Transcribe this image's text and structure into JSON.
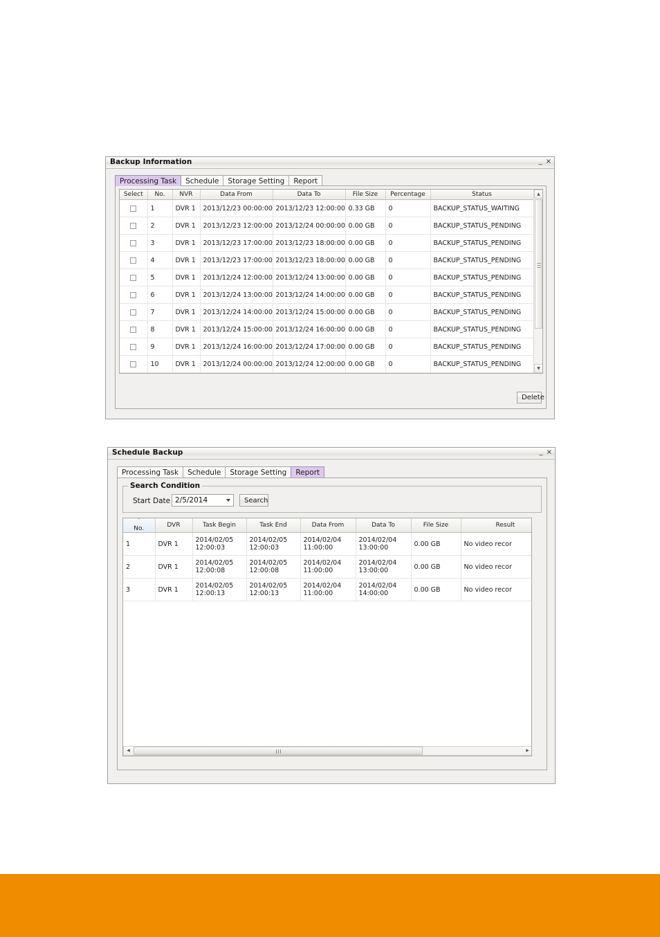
{
  "page": {
    "background": "#ffffff",
    "footer_band_color": "#f08c00"
  },
  "window_backup_information": {
    "title": "Backup Information",
    "minimize_label": "_",
    "close_label": "×",
    "tabs": [
      {
        "label": "Processing Task",
        "selected": true
      },
      {
        "label": "Schedule",
        "selected": false
      },
      {
        "label": "Storage Setting",
        "selected": false
      },
      {
        "label": "Report",
        "selected": false
      }
    ],
    "selected_tab_color": "#ddc8ef",
    "table": {
      "columns": [
        "Select",
        "No.",
        "NVR",
        "Data From",
        "Data To",
        "File Size",
        "Percentage",
        "Status"
      ],
      "rows": [
        {
          "no": "1",
          "nvr": "DVR 1",
          "data_from": "2013/12/23 00:00:00",
          "data_to": "2013/12/23 12:00:00",
          "file_size": "0.33 GB",
          "percentage": "0",
          "status": "BACKUP_STATUS_WAITING"
        },
        {
          "no": "2",
          "nvr": "DVR 1",
          "data_from": "2013/12/23 12:00:00",
          "data_to": "2013/12/24 00:00:00",
          "file_size": "0.00 GB",
          "percentage": "0",
          "status": "BACKUP_STATUS_PENDING"
        },
        {
          "no": "3",
          "nvr": "DVR 1",
          "data_from": "2013/12/23 17:00:00",
          "data_to": "2013/12/23 18:00:00",
          "file_size": "0.00 GB",
          "percentage": "0",
          "status": "BACKUP_STATUS_PENDING"
        },
        {
          "no": "4",
          "nvr": "DVR 1",
          "data_from": "2013/12/23 17:00:00",
          "data_to": "2013/12/23 18:00:00",
          "file_size": "0.00 GB",
          "percentage": "0",
          "status": "BACKUP_STATUS_PENDING"
        },
        {
          "no": "5",
          "nvr": "DVR 1",
          "data_from": "2013/12/24 12:00:00",
          "data_to": "2013/12/24 13:00:00",
          "file_size": "0.00 GB",
          "percentage": "0",
          "status": "BACKUP_STATUS_PENDING"
        },
        {
          "no": "6",
          "nvr": "DVR 1",
          "data_from": "2013/12/24 13:00:00",
          "data_to": "2013/12/24 14:00:00",
          "file_size": "0.00 GB",
          "percentage": "0",
          "status": "BACKUP_STATUS_PENDING"
        },
        {
          "no": "7",
          "nvr": "DVR 1",
          "data_from": "2013/12/24 14:00:00",
          "data_to": "2013/12/24 15:00:00",
          "file_size": "0.00 GB",
          "percentage": "0",
          "status": "BACKUP_STATUS_PENDING"
        },
        {
          "no": "8",
          "nvr": "DVR 1",
          "data_from": "2013/12/24 15:00:00",
          "data_to": "2013/12/24 16:00:00",
          "file_size": "0.00 GB",
          "percentage": "0",
          "status": "BACKUP_STATUS_PENDING"
        },
        {
          "no": "9",
          "nvr": "DVR 1",
          "data_from": "2013/12/24 16:00:00",
          "data_to": "2013/12/24 17:00:00",
          "file_size": "0.00 GB",
          "percentage": "0",
          "status": "BACKUP_STATUS_PENDING"
        },
        {
          "no": "10",
          "nvr": "DVR 1",
          "data_from": "2013/12/24 00:00:00",
          "data_to": "2013/12/24 12:00:00",
          "file_size": "0.00 GB",
          "percentage": "0",
          "status": "BACKUP_STATUS_PENDING"
        }
      ]
    },
    "scrollbar": {
      "up_arrow": "▲",
      "down_arrow": "▼"
    },
    "delete_button": "Delete"
  },
  "window_schedule_backup": {
    "title": "Schedule Backup",
    "minimize_label": "_",
    "close_label": "×",
    "tabs": [
      {
        "label": "Processing Task",
        "selected": false
      },
      {
        "label": "Schedule",
        "selected": false
      },
      {
        "label": "Storage Setting",
        "selected": false
      },
      {
        "label": "Report",
        "selected": true
      }
    ],
    "selected_tab_color": "#ddc8ef",
    "search_condition": {
      "group_title": "Search Condition",
      "start_date_label": "Start Date",
      "start_date_value": "2/5/2014",
      "search_button": "Search"
    },
    "table": {
      "columns": [
        "No.",
        "DVR",
        "Task Begin",
        "Task End",
        "Data From",
        "Data To",
        "File Size",
        "Result"
      ],
      "sorted_column": "No.",
      "sort_indicator": "˄",
      "rows": [
        {
          "no": "1",
          "dvr": "DVR 1",
          "task_begin_date": "2014/02/05",
          "task_begin_time": "12:00:03",
          "task_end_date": "2014/02/05",
          "task_end_time": "12:00:03",
          "data_from_date": "2014/02/04",
          "data_from_time": "11:00:00",
          "data_to_date": "2014/02/04",
          "data_to_time": "13:00:00",
          "file_size": "0.00 GB",
          "result": "No video recor"
        },
        {
          "no": "2",
          "dvr": "DVR 1",
          "task_begin_date": "2014/02/05",
          "task_begin_time": "12:00:08",
          "task_end_date": "2014/02/05",
          "task_end_time": "12:00:08",
          "data_from_date": "2014/02/04",
          "data_from_time": "11:00:00",
          "data_to_date": "2014/02/04",
          "data_to_time": "13:00:00",
          "file_size": "0.00 GB",
          "result": "No video recor"
        },
        {
          "no": "3",
          "dvr": "DVR 1",
          "task_begin_date": "2014/02/05",
          "task_begin_time": "12:00:13",
          "task_end_date": "2014/02/05",
          "task_end_time": "12:00:13",
          "data_from_date": "2014/02/04",
          "data_from_time": "11:00:00",
          "data_to_date": "2014/02/04",
          "data_to_time": "14:00:00",
          "file_size": "0.00 GB",
          "result": "No video recor"
        }
      ]
    },
    "hscrollbar": {
      "left_arrow": "◀",
      "right_arrow": "▶"
    }
  }
}
